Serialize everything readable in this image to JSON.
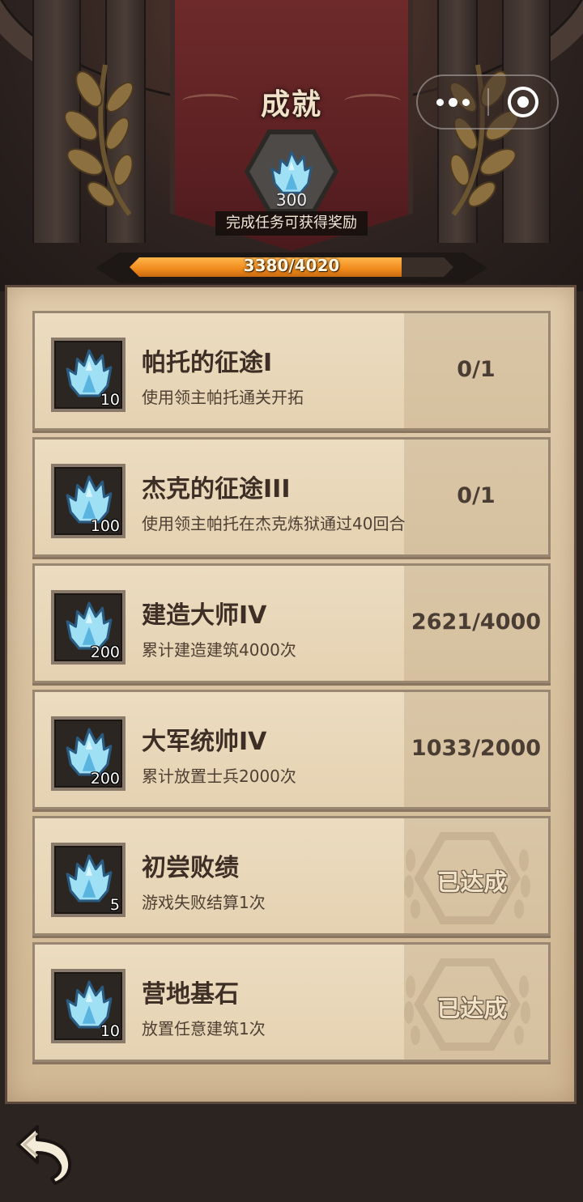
{
  "header": {
    "title": "成就",
    "reward_amount": "300",
    "reward_caption": "完成任务可获得奖励",
    "progress_text": "3380/4020",
    "progress_fraction": 0.84
  },
  "capsule": {
    "more_icon": "more-dots-icon",
    "close_icon": "target-close-icon"
  },
  "achievements": [
    {
      "title": "帕托的征途I",
      "desc": "使用领主帕托通关开拓",
      "reward": "10",
      "progress": "0/1",
      "completed": false
    },
    {
      "title": "杰克的征途III",
      "desc": "使用领主帕托在杰克炼狱通过40回合",
      "reward": "100",
      "progress": "0/1",
      "completed": false
    },
    {
      "title": "建造大师IV",
      "desc": "累计建造建筑4000次",
      "reward": "200",
      "progress": "2621/4000",
      "completed": false
    },
    {
      "title": "大军统帅IV",
      "desc": "累计放置士兵2000次",
      "reward": "200",
      "progress": "1033/2000",
      "completed": false
    },
    {
      "title": "初尝败绩",
      "desc": "游戏失败结算1次",
      "reward": "5",
      "progress": "已达成",
      "completed": true
    },
    {
      "title": "营地基石",
      "desc": "放置任意建筑1次",
      "reward": "10",
      "progress": "已达成",
      "completed": true
    }
  ],
  "footer": {
    "back_icon": "back-arrow-icon"
  },
  "colors": {
    "accent_orange": "#f08a1c",
    "banner_red": "#6e2a2a",
    "parchment": "#e1ccac",
    "gem_blue": "#8fd8f0"
  }
}
